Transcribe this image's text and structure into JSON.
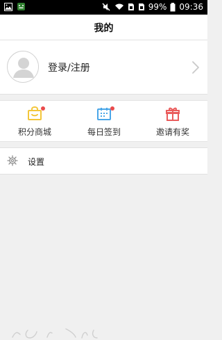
{
  "status_bar": {
    "battery_percent": "99%",
    "time": "09:36"
  },
  "header": {
    "title": "我的"
  },
  "profile": {
    "login_label": "登录/注册"
  },
  "features": {
    "items": [
      {
        "label": "积分商城",
        "icon": "shopping-bag-icon",
        "color": "#f3c63a"
      },
      {
        "label": "每日签到",
        "icon": "calendar-icon",
        "color": "#4aa6e8"
      },
      {
        "label": "邀请有奖",
        "icon": "gift-icon",
        "color": "#ea5b5b"
      }
    ]
  },
  "settings": {
    "label": "设置"
  },
  "theme": {
    "accent_red": "#ea4b4b",
    "icon_gray": "#8e8e8e",
    "background": "#f0f0f0"
  }
}
